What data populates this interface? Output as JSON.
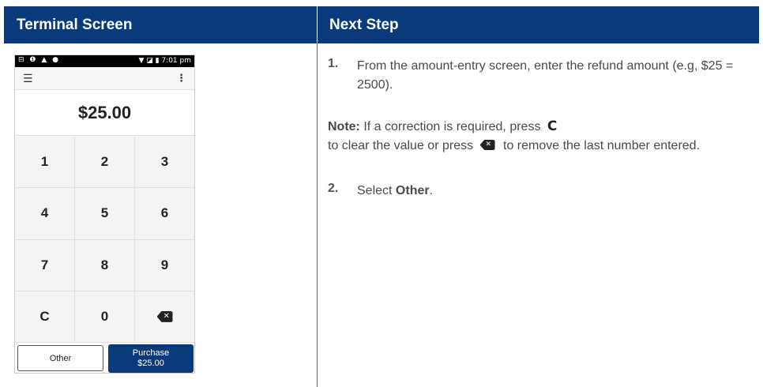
{
  "header": {
    "left_title": "Terminal Screen",
    "right_title": "Next Step",
    "color": "#0a3a7a"
  },
  "terminal": {
    "status_bar": {
      "left_icons": "⊟ ❶ ▲ ●",
      "right_text": "▼ ◪ ▮ 7:01 pm"
    },
    "app_bar": {
      "menu_icon": "menu-icon",
      "more_icon": "more-vertical-icon"
    },
    "amount": "$25.00",
    "keypad": [
      "1",
      "2",
      "3",
      "4",
      "5",
      "6",
      "7",
      "8",
      "9",
      "C",
      "0"
    ],
    "backspace_icon": "backspace-icon",
    "buttons": {
      "other": "Other",
      "purchase_line1": "Purchase",
      "purchase_line2": "$25.00"
    }
  },
  "steps": {
    "step1_num": "1.",
    "step1_text": "From the amount-entry screen, enter the refund amount (e.g, $25 = 2500).",
    "note_label": "Note:",
    "note_part1": "If a correction is required, press",
    "note_c": "C",
    "note_part2": "to clear the value or press",
    "note_part3": "to remove the last number entered.",
    "step2_num": "2.",
    "step2_prefix": "Select",
    "step2_bold": "Other",
    "step2_suffix": "."
  }
}
